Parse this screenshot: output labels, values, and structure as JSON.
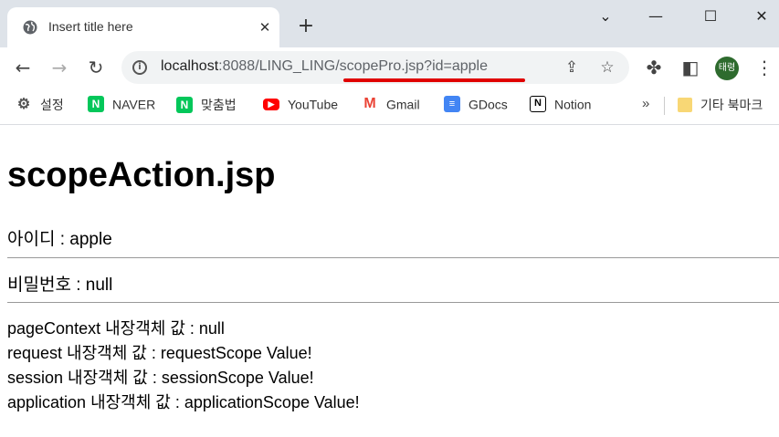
{
  "tab": {
    "title": "Insert title here",
    "close": "✕",
    "new_tab": "+"
  },
  "window": {
    "minimize": "⌄",
    "restore": "—",
    "maximize": "☐",
    "close": "✕"
  },
  "omnibox": {
    "host": "localhost",
    "path": ":8088/LING_LING/scopePro.jsp?id=apple",
    "underline_color": "#e00000"
  },
  "profile": {
    "initials": "태령"
  },
  "bookmarks": [
    {
      "label": "설정",
      "icon": "gear-icon"
    },
    {
      "label": "NAVER",
      "icon": "naver-icon"
    },
    {
      "label": "맞춤법",
      "icon": "naver-icon"
    },
    {
      "label": "YouTube",
      "icon": "youtube-icon"
    },
    {
      "label": "Gmail",
      "icon": "gmail-icon"
    },
    {
      "label": "GDocs",
      "icon": "gdocs-icon"
    },
    {
      "label": "Notion",
      "icon": "notion-icon"
    },
    {
      "label": "기타 북마크",
      "icon": "folder-icon"
    }
  ],
  "page": {
    "title": "scopeAction.jsp",
    "id_line": "아이디 : apple",
    "pw_line": "비밀번호 : null",
    "scope_lines": [
      "pageContext 내장객체 값 : null",
      "request 내장객체 값 : requestScope Value!",
      "session 내장객체 값 : sessionScope Value!",
      "application 내장객체 값 : applicationScope Value!"
    ]
  }
}
